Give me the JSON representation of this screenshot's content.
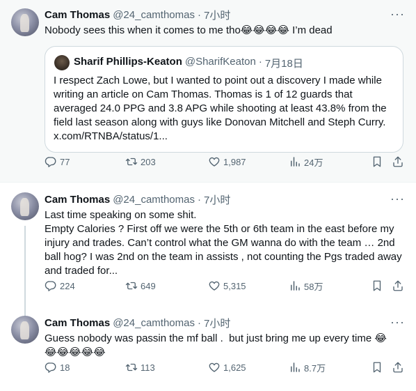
{
  "tweets": [
    {
      "author": "Cam Thomas",
      "handle": "@24_camthomas",
      "sep": "·",
      "time": "7小时",
      "text": "Nobody sees this when it comes to me tho😂😂😂😂 I’m dead",
      "quote": {
        "author": "Sharif Phillips-Keaton",
        "handle": "@SharifKeaton",
        "sep": "·",
        "time": "7月18日",
        "text": "I respect Zach Lowe, but I wanted to point out a discovery I made while writing an article on Cam Thomas. Thomas is 1 of 12 guards that averaged 24.0 PPG and 3.8 APG while shooting at least 43.8% from the field last season along with guys like Donovan Mitchell and Steph Curry. x.com/RTNBA/status/1..."
      },
      "stats": {
        "replies": "77",
        "reposts": "203",
        "likes": "1,987",
        "views": "24万"
      }
    },
    {
      "author": "Cam Thomas",
      "handle": "@24_camthomas",
      "sep": "·",
      "time": "7小时",
      "text": "Last time speaking on some shit.\nEmpty Calories ? First off we were the 5th or 6th team in the east before my injury and trades. Can’t control what the GM wanna do with the team … 2nd ball hog? I was 2nd on the team in assists , not counting the Pgs traded away and traded for...",
      "stats": {
        "replies": "224",
        "reposts": "649",
        "likes": "5,315",
        "views": "58万"
      }
    },
    {
      "author": "Cam Thomas",
      "handle": "@24_camthomas",
      "sep": "·",
      "time": "7小时",
      "text": "Guess nobody was passin the mf ball .  but just bring me up every time 😂\n😂😂😂😂😂",
      "stats": {
        "replies": "18",
        "reposts": "113",
        "likes": "1,625",
        "views": "8.7万"
      }
    }
  ],
  "more_label": "···",
  "icons": [
    "more-icon",
    "reply-icon",
    "repost-icon",
    "like-icon",
    "views-icon",
    "bookmark-icon",
    "share-icon"
  ],
  "colors": {
    "muted": "#536471",
    "text": "#0f1419",
    "border": "#cfd9de",
    "highlight_bg": "#f7f9f9"
  }
}
